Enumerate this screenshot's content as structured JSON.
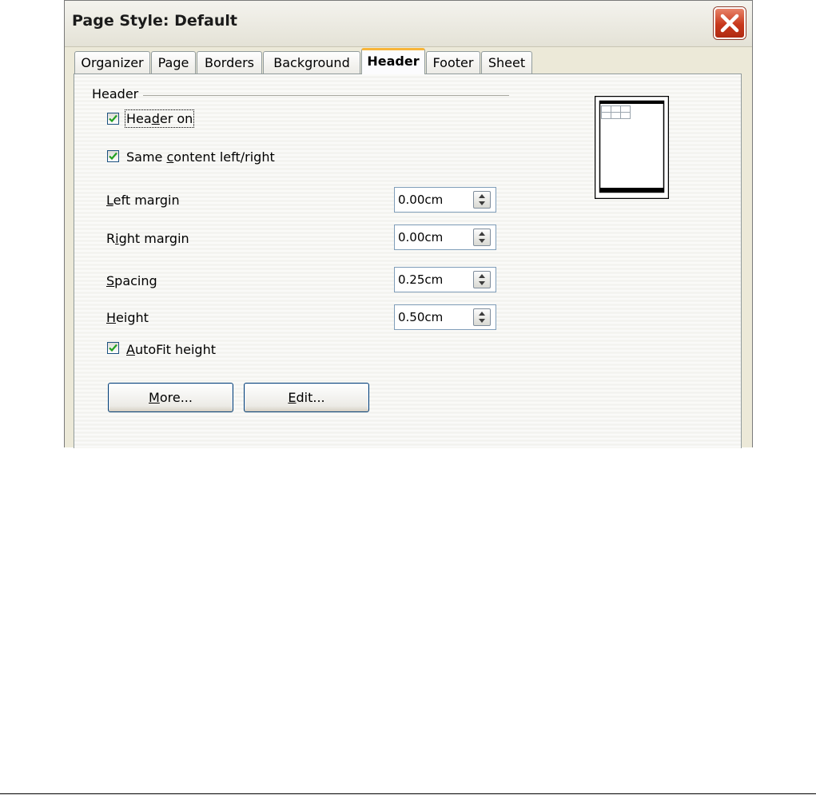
{
  "dialog": {
    "title": "Page Style: Default",
    "close_icon": "close-icon"
  },
  "tabs": [
    {
      "label": "Organizer",
      "active": false
    },
    {
      "label": "Page",
      "active": false
    },
    {
      "label": "Borders",
      "active": false
    },
    {
      "label": "Background",
      "active": false
    },
    {
      "label": "Header",
      "active": true
    },
    {
      "label": "Footer",
      "active": false
    },
    {
      "label": "Sheet",
      "active": false
    }
  ],
  "header_section": {
    "label": "Header",
    "header_on": {
      "checked": true
    },
    "same_content": {
      "checked": true
    },
    "left_margin": {
      "value": "0.00cm"
    },
    "right_margin": {
      "value": "0.00cm"
    },
    "spacing": {
      "value": "0.25cm"
    },
    "height": {
      "value": "0.50cm"
    },
    "autofit": {
      "checked": true
    }
  },
  "buttons": {
    "more_label": "More...",
    "edit_label": "Edit..."
  },
  "colors": {
    "accent_tab": "#f7b53a",
    "close_button": "#c8381c",
    "checkmark": "#21a121"
  }
}
